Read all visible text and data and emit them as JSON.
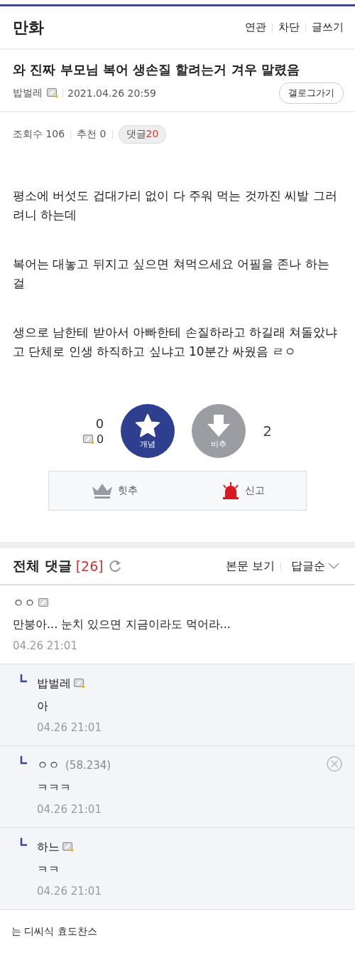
{
  "header": {
    "title": "만화",
    "links": [
      "연관",
      "차단",
      "글쓰기"
    ]
  },
  "post": {
    "title": "와 진짜 부모님 복어 생손질 할려는거 겨우 말렸음",
    "author": "밥벌레",
    "author_fixed_nick": true,
    "date": "2021.04.26 20:59",
    "gallog_button": "갤로그가기",
    "stats": [
      {
        "kind": "plain",
        "label": "조회수",
        "value": "106"
      },
      {
        "kind": "plain",
        "label": "추천",
        "value": "0"
      },
      {
        "kind": "pill",
        "label": "댓글",
        "value": "20"
      }
    ],
    "paragraphs": [
      "평소에 버섯도 겁대가리 없이 다 주워 먹는 것까진 씨발 그러려니 하는데",
      "복어는 대놓고 뒤지고 싶으면 쳐먹으세요 어필을 존나 하는 걸",
      "생으로 남한테 받아서 아빠한테 손질하라고 하길래 쳐돌았냐고 단체로 인생 하직하고 싶냐고 10분간 싸웠음 ㄹㅇ"
    ]
  },
  "votes": {
    "up_count": "0",
    "fixed_up_count": "0",
    "up_label": "개념",
    "down_label": "비추",
    "down_count": "2"
  },
  "actions": [
    {
      "kind": "crown",
      "label": "힛추"
    },
    {
      "kind": "siren",
      "label": "신고"
    }
  ],
  "comments_header": {
    "title": "전체 댓글",
    "count": "[26]",
    "view_body": "본문 보기",
    "sort": "답글순"
  },
  "comments": [
    {
      "kind": "comment",
      "author": "ㅇㅇ",
      "fixed_nick": false,
      "text": "만붕아... 눈치 있으면 지금이라도 먹어라...",
      "time": "04.26 21:01"
    },
    {
      "kind": "reply",
      "author": "밥벌레",
      "fixed_nick": true,
      "text": "아",
      "time": "04.26 21:01"
    },
    {
      "kind": "reply",
      "author": "ㅇㅇ",
      "ip": "(58.234)",
      "deletable": true,
      "text": "ㅋㅋㅋ",
      "time": "04.26 21:01"
    },
    {
      "kind": "reply",
      "author": "하느",
      "fixed_nick": true,
      "text": "ㅋㅋ",
      "time": "04.26 21:01"
    }
  ],
  "footer_note": "는 디씨식 효도찬스"
}
